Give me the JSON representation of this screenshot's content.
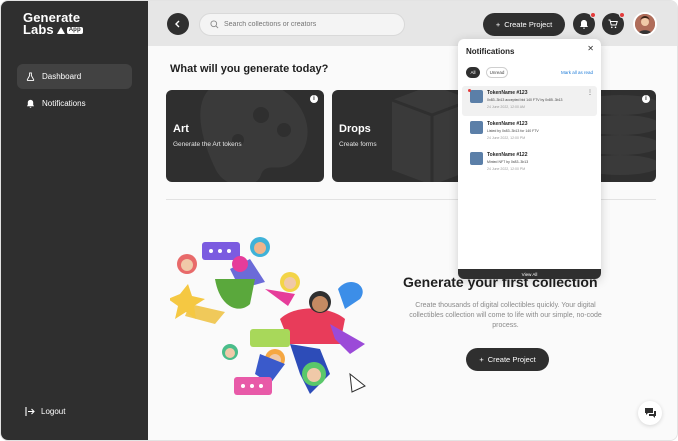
{
  "sidebar": {
    "logo_line1": "Generate",
    "logo_line2": "Labs",
    "logo_badge": "App",
    "items": [
      {
        "label": "Dashboard",
        "icon": "flask-icon",
        "active": true
      },
      {
        "label": "Notifications",
        "icon": "bell-icon",
        "active": false
      }
    ],
    "logout_label": "Logout"
  },
  "topbar": {
    "search_placeholder": "Search collections or creators",
    "create_label": "Create Project"
  },
  "main": {
    "headline": "What will you generate today?",
    "cards": [
      {
        "title": "Art",
        "subtitle": "Generate the Art tokens"
      },
      {
        "title": "Drops",
        "subtitle": "Create forms"
      },
      {
        "title": "",
        "subtitle": ""
      }
    ],
    "empty_title": "Generate your first collection",
    "empty_desc": "Create thousands of digital collectibles quickly. Your digital collectibles collection will come to life with our simple, no-code process.",
    "create_label": "Create Project"
  },
  "notifications": {
    "title": "Notifications",
    "filter_all": "All",
    "filter_unread": "Unread",
    "mark_all": "Mark all as read",
    "view_all": "View All",
    "items": [
      {
        "title": "TokenName #123",
        "line": "0x83..3b13 accepted bid 140 FTV by 0x85..3b13",
        "date": "24 June 2022, 12:00 AM",
        "unread": true
      },
      {
        "title": "TokenName #123",
        "line": "Listed by 0x83..3b13 for 140 FTV",
        "date": "24 June 2022, 12:00 PM",
        "unread": false
      },
      {
        "title": "TokenName #122",
        "line": "Minted NFT by 0x83..3b13",
        "date": "24 June 2022, 12:00 PM",
        "unread": false
      }
    ]
  },
  "colors": {
    "sidebar": "#2f2f2f",
    "accent_dark": "#2f2f2f",
    "badge": "#e33c3c",
    "link": "#1d7bd8"
  }
}
